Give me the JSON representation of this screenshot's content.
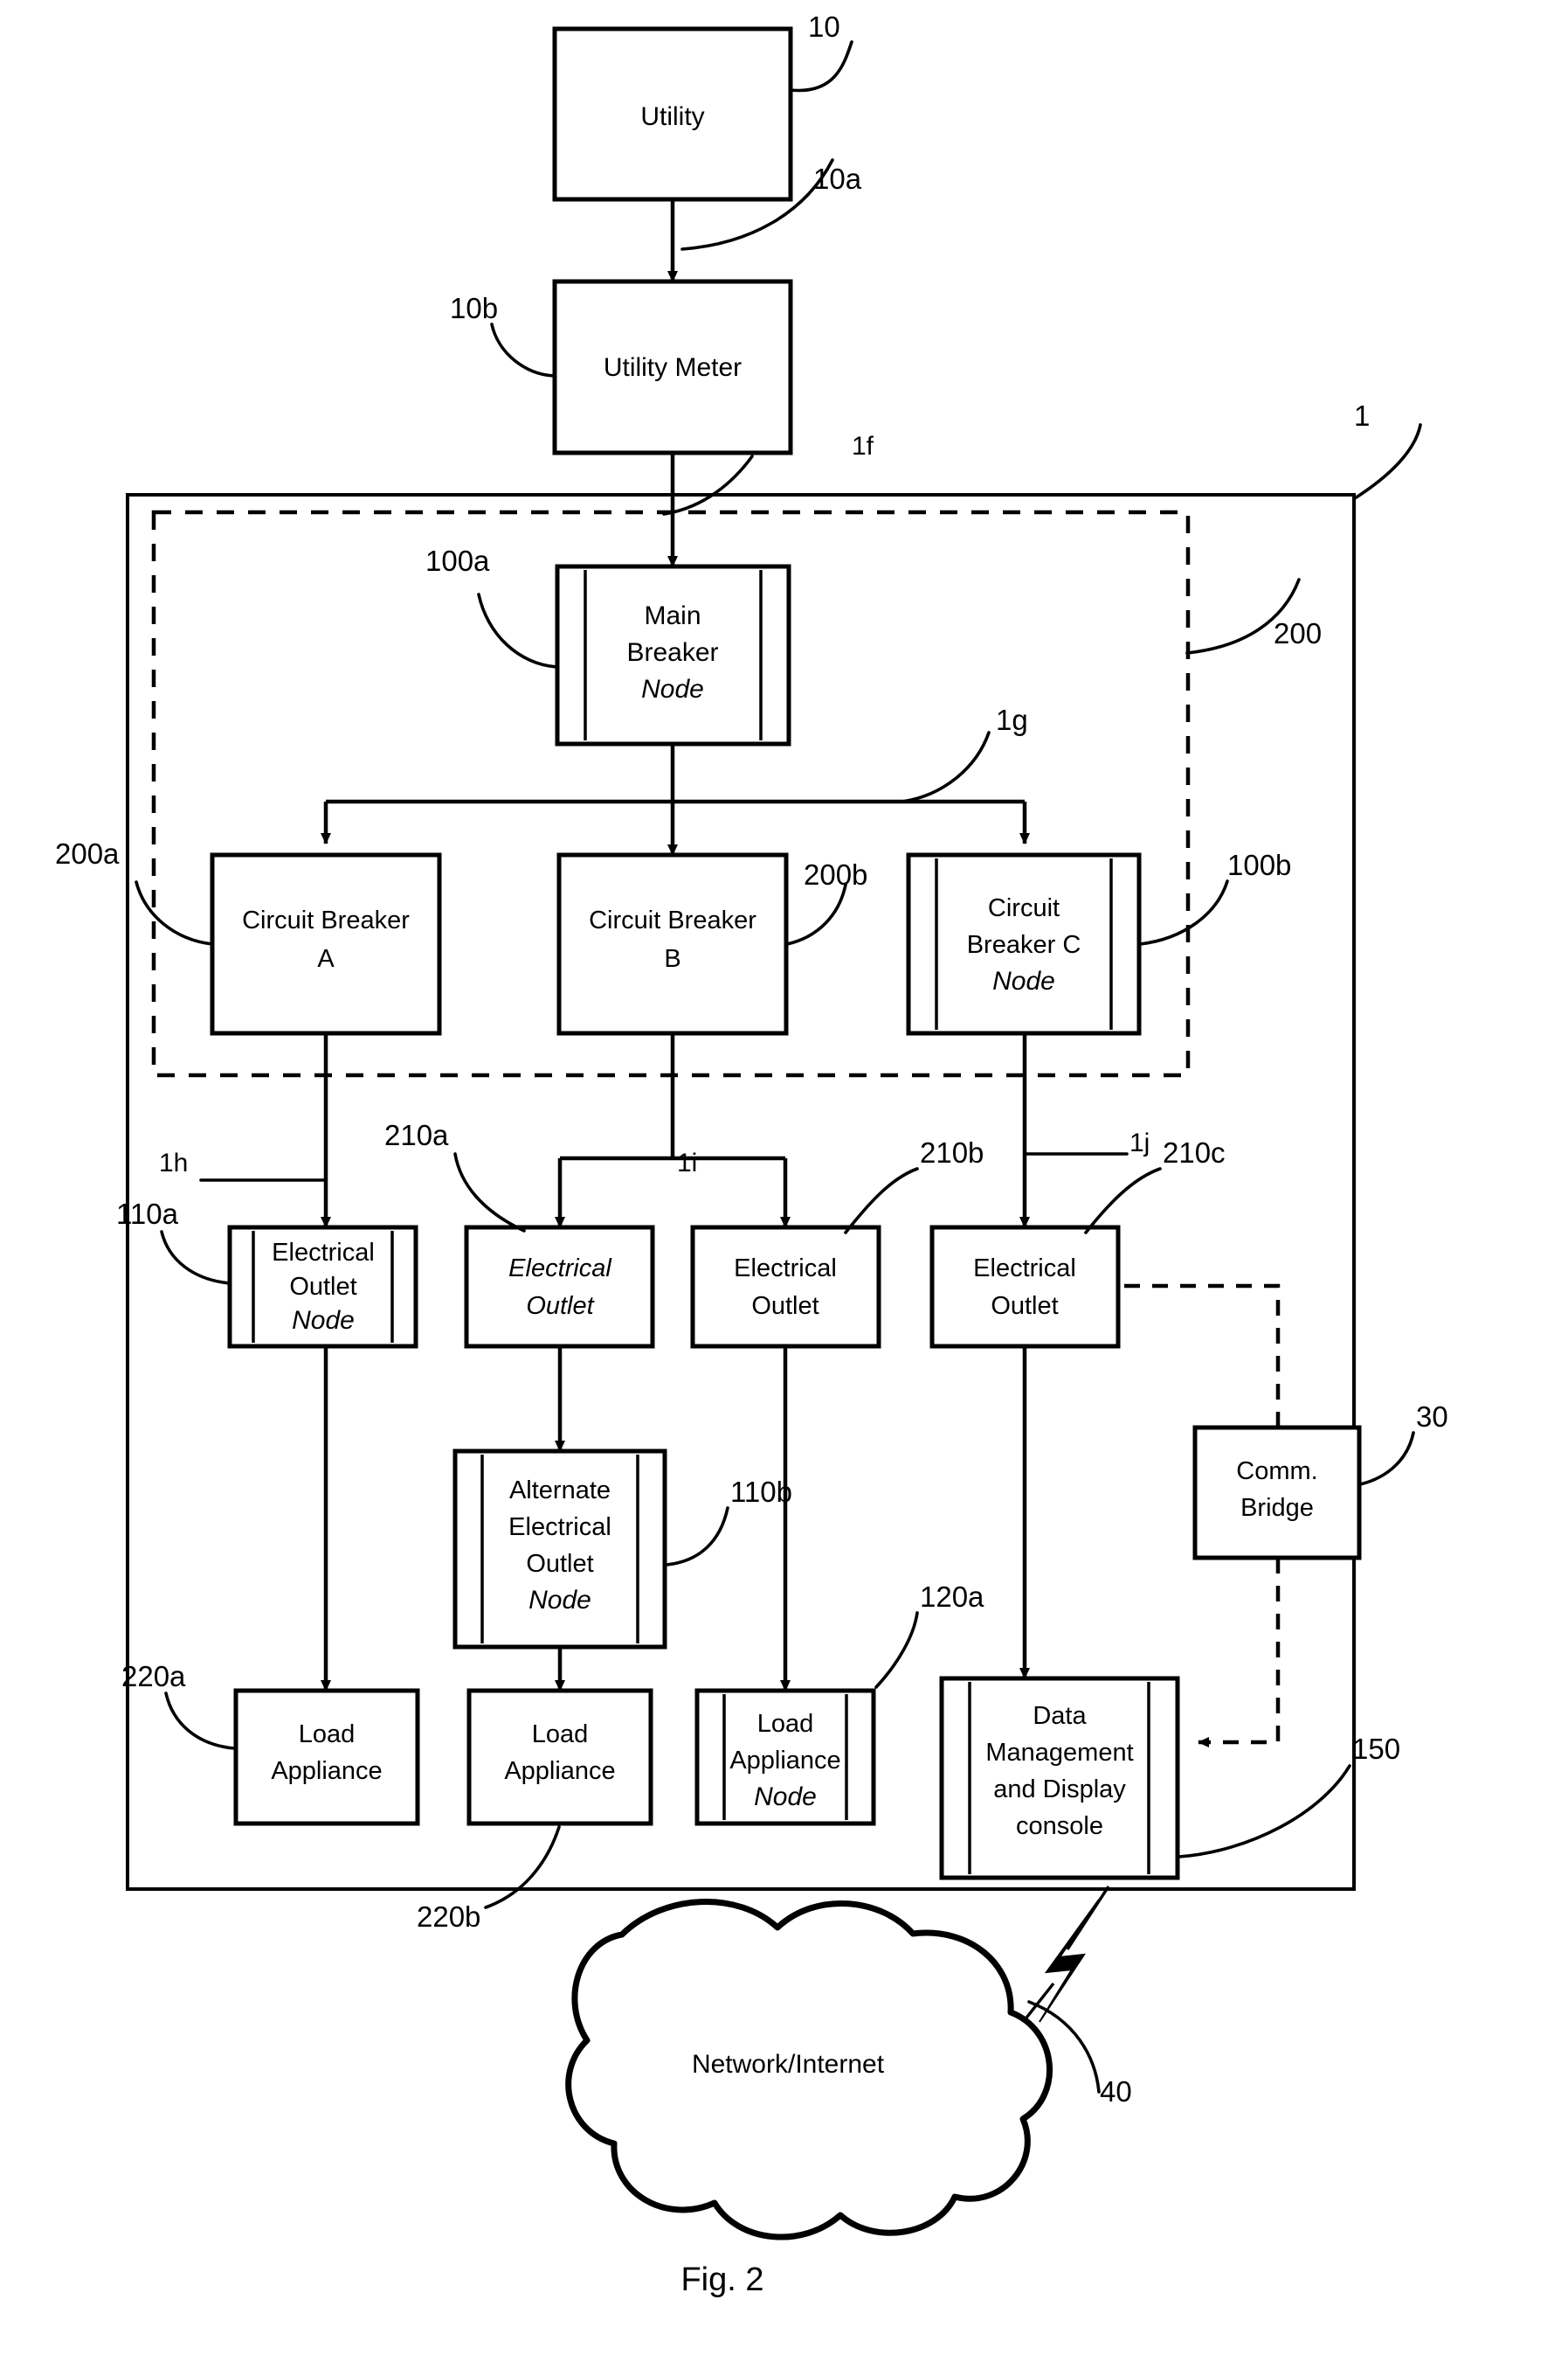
{
  "figure": {
    "caption": "Fig. 2",
    "title": "Electrical power monitoring system block diagram"
  },
  "blocks": {
    "utility": {
      "label": "Utility",
      "ref": "10"
    },
    "utility_meter": {
      "label": "Utility Meter",
      "ref": "10b"
    },
    "main_breaker": {
      "label_line1": "Main",
      "label_line2": "Breaker",
      "node_word": "Node",
      "ref": "100a"
    },
    "circuit_breaker_a": {
      "label_line1": "Circuit Breaker",
      "label_line2": "A",
      "ref": "200a"
    },
    "circuit_breaker_b": {
      "label_line1": "Circuit Breaker",
      "label_line2": "B",
      "ref": "200b"
    },
    "circuit_breaker_c": {
      "label_line1": "Circuit",
      "label_line2": "Breaker C",
      "node_word": "Node",
      "ref": "100b"
    },
    "electrical_outlet_node": {
      "label_line1": "Electrical",
      "label_line2": "Outlet",
      "node_word": "Node",
      "ref": "110a"
    },
    "electrical_outlet_a": {
      "label_line1": "Electrical",
      "label_line2": "Outlet",
      "ref": "210a"
    },
    "electrical_outlet_b": {
      "label_line1": "Electrical",
      "label_line2": "Outlet",
      "ref": "210b"
    },
    "electrical_outlet_c": {
      "label_line1": "Electrical",
      "label_line2": "Outlet",
      "ref": "210c"
    },
    "alternate_outlet_node": {
      "label_line1": "Alternate",
      "label_line2": "Electrical",
      "label_line3": "Outlet",
      "node_word": "Node",
      "ref": "110b"
    },
    "load_appliance_a": {
      "label_line1": "Load",
      "label_line2": "Appliance",
      "ref": "220a"
    },
    "load_appliance_b": {
      "label_line1": "Load",
      "label_line2": "Appliance",
      "ref": "220b"
    },
    "load_appliance_node": {
      "label_line1": "Load",
      "label_line2": "Appliance",
      "node_word": "Node",
      "ref": "120a"
    },
    "data_console": {
      "label_line1": "Data",
      "label_line2": "Management",
      "label_line3": "and Display",
      "label_line4": "console",
      "ref": "150"
    },
    "comm_bridge": {
      "label_line1": "Comm.",
      "label_line2": "Bridge",
      "ref": "30"
    },
    "network_cloud": {
      "label": "Network/Internet",
      "ref": "40"
    }
  },
  "enclosures": {
    "premises": {
      "ref": "1"
    },
    "panel": {
      "ref": "200"
    }
  },
  "connection_refs": {
    "utility_to_meter": "10a",
    "meter_to_main": "1f",
    "main_to_breakers": "1g",
    "breaker_a_to_outlet": "1h",
    "breaker_b_to_outlets": "1i",
    "breaker_c_to_outlet": "1j"
  }
}
